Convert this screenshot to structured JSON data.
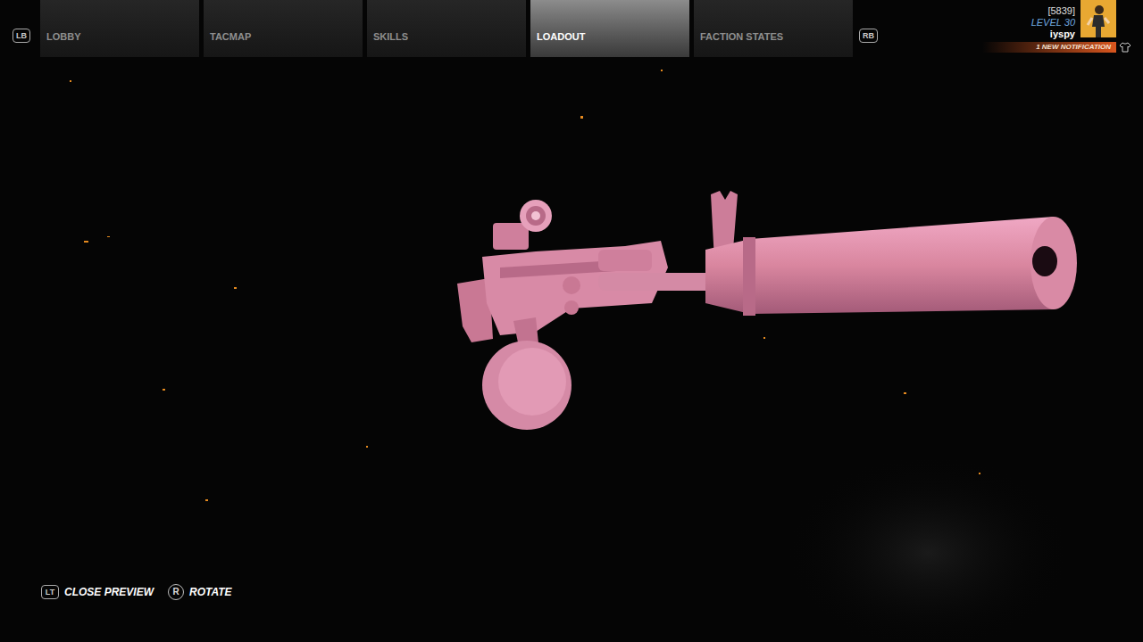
{
  "bumpers": {
    "left": "LB",
    "right": "RB"
  },
  "tabs": [
    {
      "label": "LOBBY",
      "selected": false
    },
    {
      "label": "TACMAP",
      "selected": false
    },
    {
      "label": "SKILLS",
      "selected": false
    },
    {
      "label": "LOADOUT",
      "selected": true
    },
    {
      "label": "FACTION STATES",
      "selected": false
    }
  ],
  "player": {
    "id": "[5839]",
    "level": "LEVEL 30",
    "name": "iyspy",
    "notification": "1 NEW NOTIFICATION"
  },
  "controls": [
    {
      "key": "LT",
      "label": "CLOSE PREVIEW"
    },
    {
      "key": "R",
      "label": "ROTATE"
    }
  ]
}
